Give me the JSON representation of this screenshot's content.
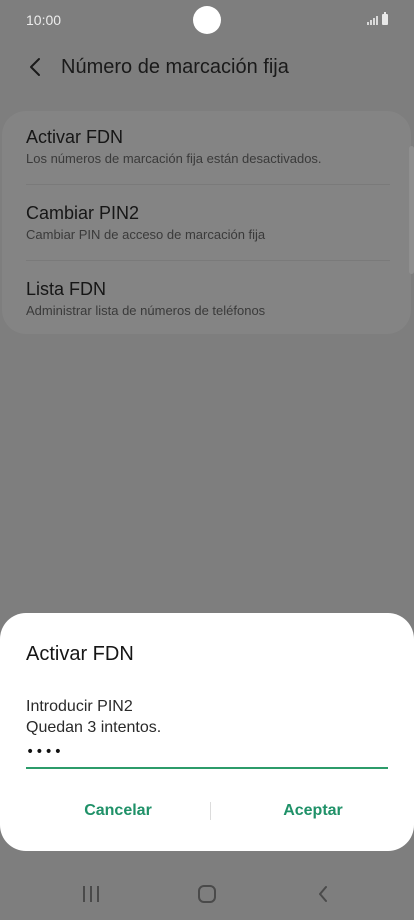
{
  "status_bar": {
    "time": "10:00",
    "icons": [
      "signal-icon",
      "battery-icon"
    ]
  },
  "header": {
    "back_icon": "chevron-left-icon",
    "title": "Número de marcación fija"
  },
  "settings": {
    "items": [
      {
        "title": "Activar FDN",
        "subtitle": "Los números de marcación fija están desactivados."
      },
      {
        "title": "Cambiar PIN2",
        "subtitle": "Cambiar PIN de acceso de marcación fija"
      },
      {
        "title": "Lista FDN",
        "subtitle": "Administrar lista de números de teléfonos"
      }
    ]
  },
  "dialog": {
    "title": "Activar FDN",
    "prompt_line1": "Introducir PIN2",
    "prompt_line2": "Quedan 3 intentos.",
    "pin_value": "1234",
    "cancel_label": "Cancelar",
    "accept_label": "Aceptar",
    "accent_color": "#1f9168"
  },
  "nav_bar": {
    "icons": [
      "recents-icon",
      "home-icon",
      "back-icon"
    ]
  }
}
